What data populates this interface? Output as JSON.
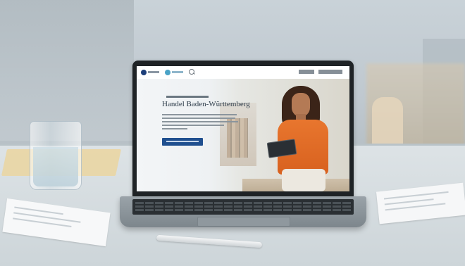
{
  "scene": {
    "description_free": true
  },
  "laptop_screen": {
    "hero": {
      "title": "Handel Baden-Württemberg"
    }
  }
}
